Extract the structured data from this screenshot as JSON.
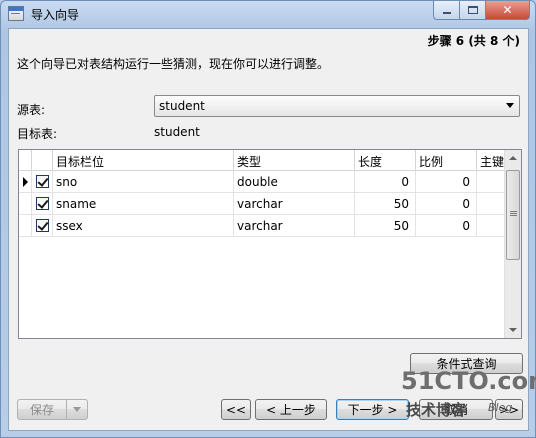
{
  "window": {
    "title": "导入向导",
    "icon": "table-import-icon"
  },
  "header": {
    "step": "步骤 6 (共 8 个)",
    "intro": "这个向导已对表结构运行一些猜测，现在你可以进行调整。"
  },
  "form": {
    "source_label": "源表:",
    "source_value": "student",
    "target_label": "目标表:",
    "target_value": "student"
  },
  "grid": {
    "columns": [
      "目标栏位",
      "类型",
      "长度",
      "比例",
      "主键"
    ],
    "rows": [
      {
        "checked": true,
        "current": true,
        "field": "sno",
        "type": "double",
        "length": "0",
        "scale": "0"
      },
      {
        "checked": true,
        "current": false,
        "field": "sname",
        "type": "varchar",
        "length": "50",
        "scale": "0"
      },
      {
        "checked": true,
        "current": false,
        "field": "ssex",
        "type": "varchar",
        "length": "50",
        "scale": "0"
      }
    ]
  },
  "buttons": {
    "filter": "条件式查询",
    "save": "保存",
    "first": "<<",
    "prev": "< 上一步",
    "next": "下一步 >",
    "cancel": "取消",
    "last": ">>"
  },
  "watermark": {
    "main": "51CTO.com",
    "sub": "技术博客",
    "blog": "Blog"
  }
}
